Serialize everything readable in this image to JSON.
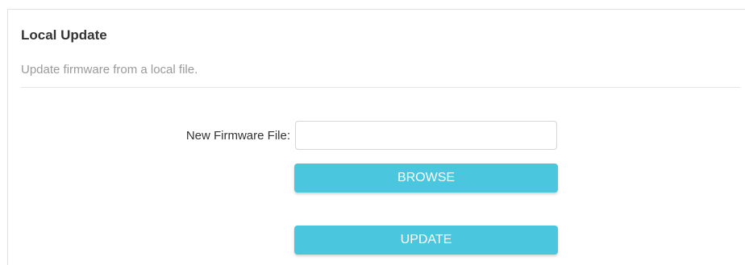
{
  "section": {
    "title": "Local Update",
    "description": "Update firmware from a local file."
  },
  "form": {
    "file_label": "New Firmware File:",
    "file_value": "",
    "browse_label": "BROWSE",
    "update_label": "UPDATE"
  },
  "colors": {
    "button_bg": "#4ac6df",
    "button_text": "#ffffff",
    "title_text": "#333333",
    "description_text": "#9a9a9a"
  }
}
